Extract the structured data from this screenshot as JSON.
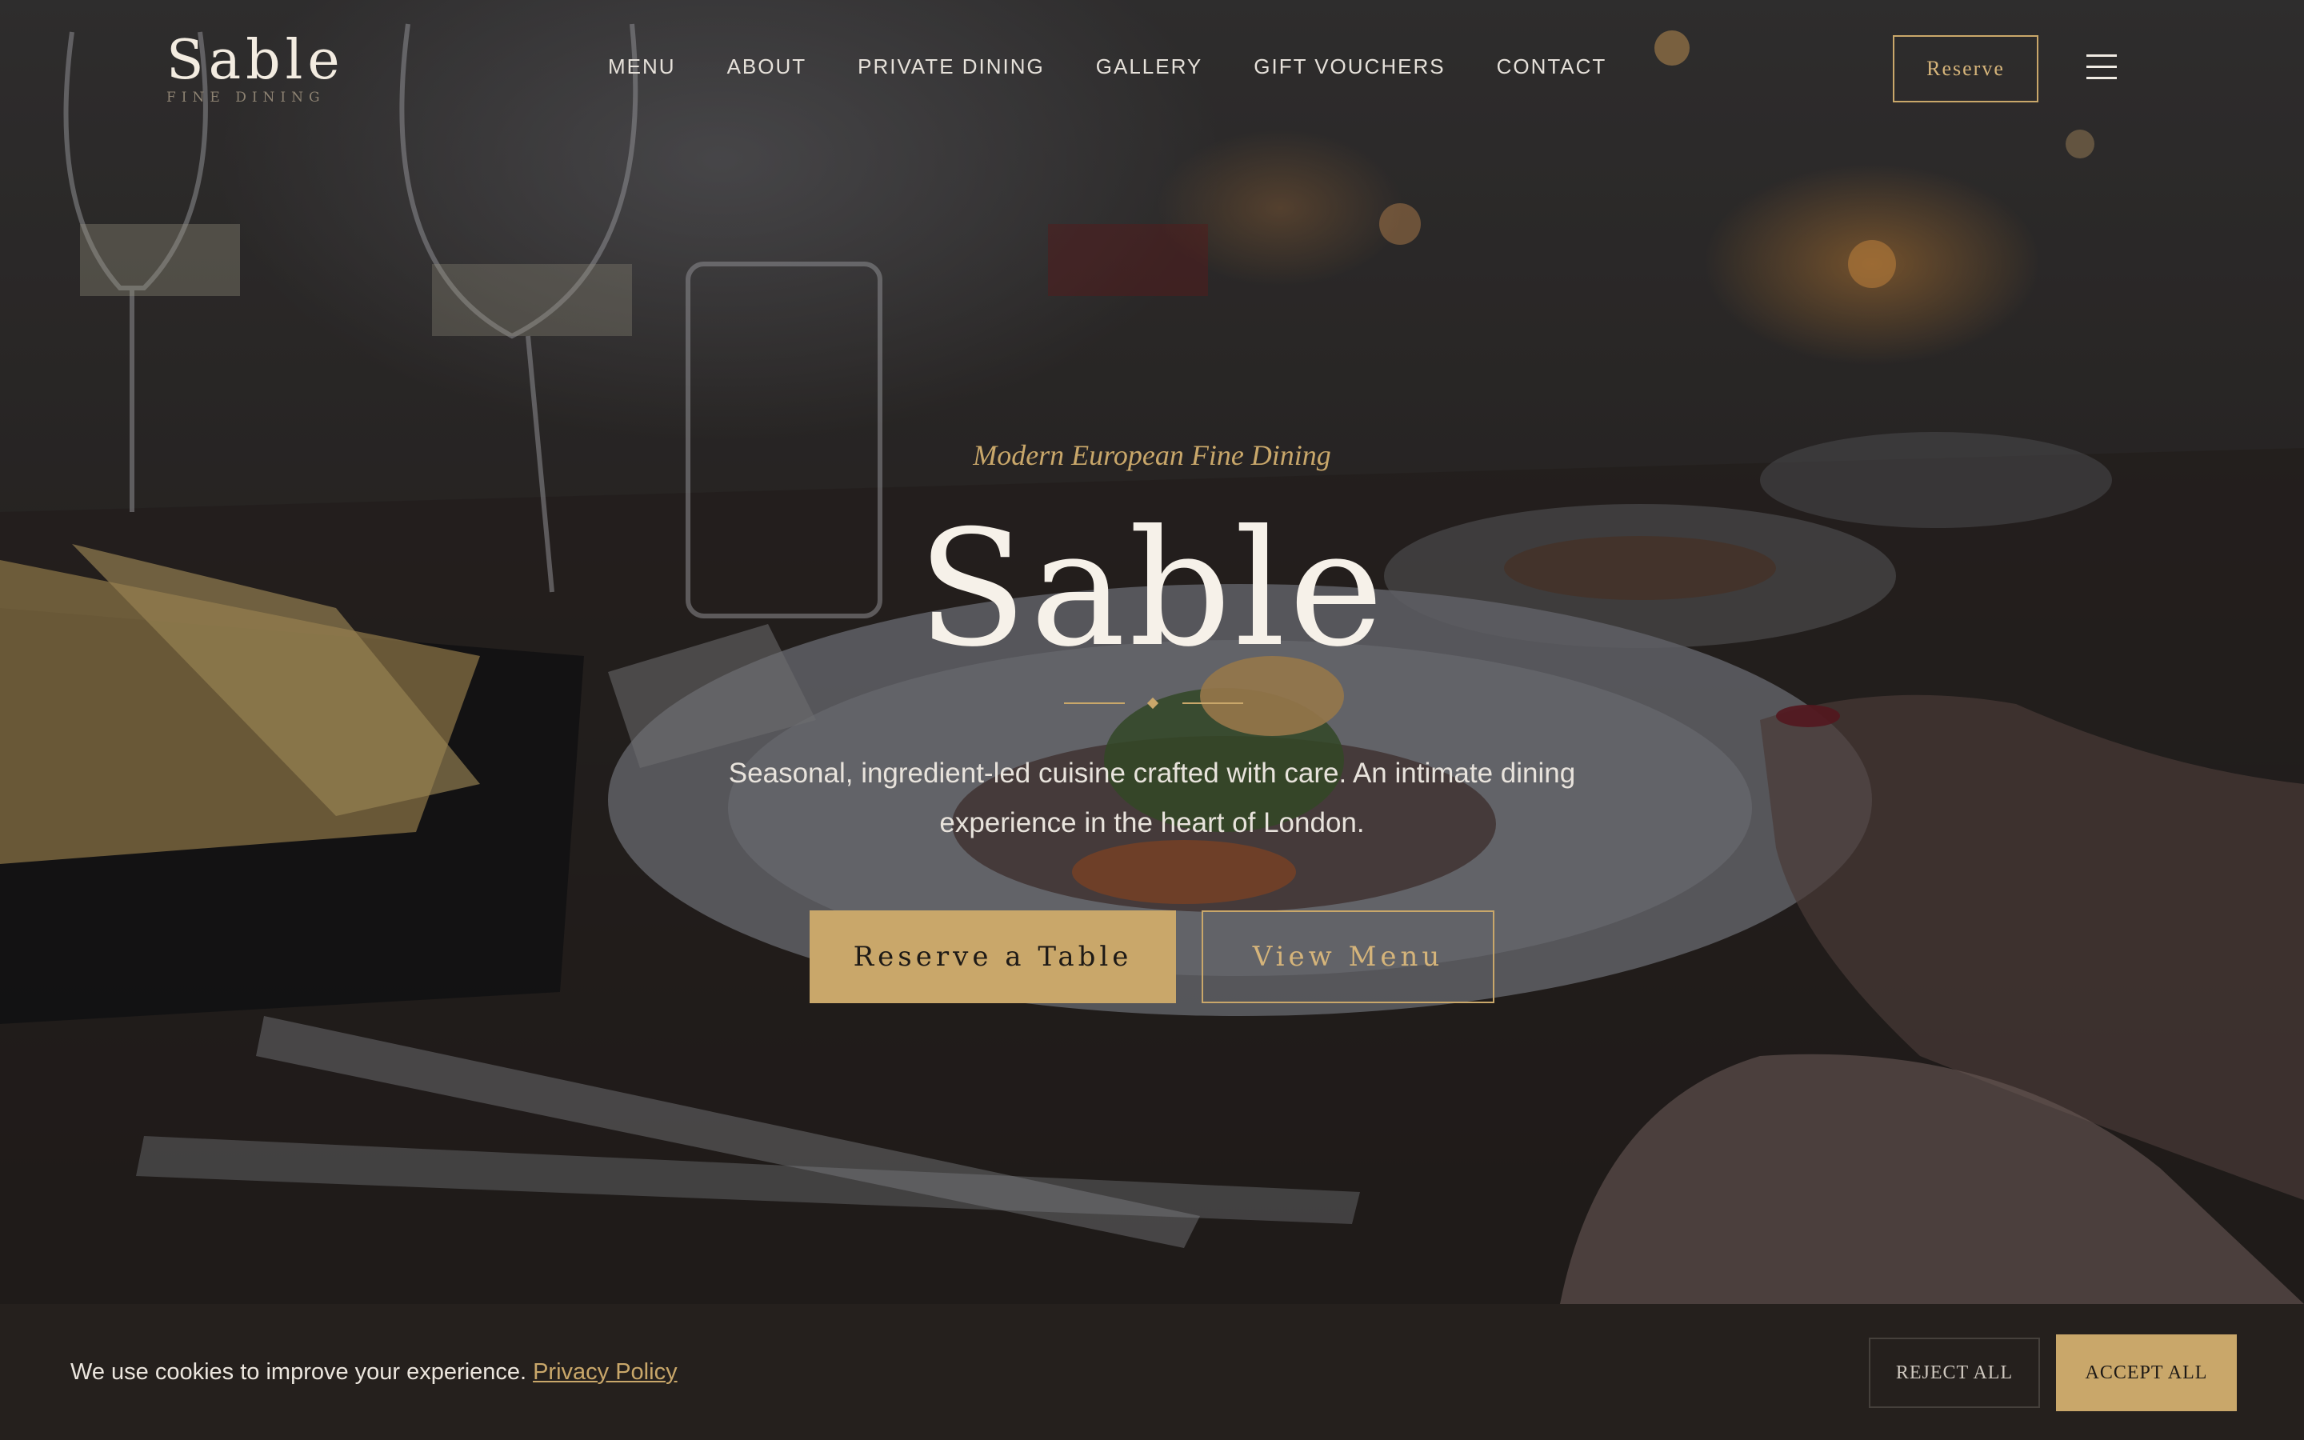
{
  "brand": {
    "name": "Sable",
    "subtitle": "FINE DINING"
  },
  "nav": {
    "items": [
      {
        "label": "MENU"
      },
      {
        "label": "ABOUT"
      },
      {
        "label": "PRIVATE DINING"
      },
      {
        "label": "GALLERY"
      },
      {
        "label": "GIFT VOUCHERS"
      },
      {
        "label": "CONTACT"
      }
    ],
    "reserve_label": "Reserve",
    "menu_icon": "hamburger-icon"
  },
  "hero": {
    "tagline": "Modern European Fine Dining",
    "title": "Sable",
    "subtitle": "Seasonal, ingredient-led cuisine crafted with care. An intimate dining experience in the heart of London.",
    "primary_cta": "Reserve a Table",
    "secondary_cta": "View Menu"
  },
  "cookie": {
    "message": "We use cookies to improve your experience.",
    "link_label": "Privacy Policy",
    "reject_label": "REJECT ALL",
    "accept_label": "ACCEPT ALL"
  },
  "colors": {
    "accent": "#c9a76a",
    "banner_bg": "#25201d",
    "text_light": "#f6f1e9"
  }
}
